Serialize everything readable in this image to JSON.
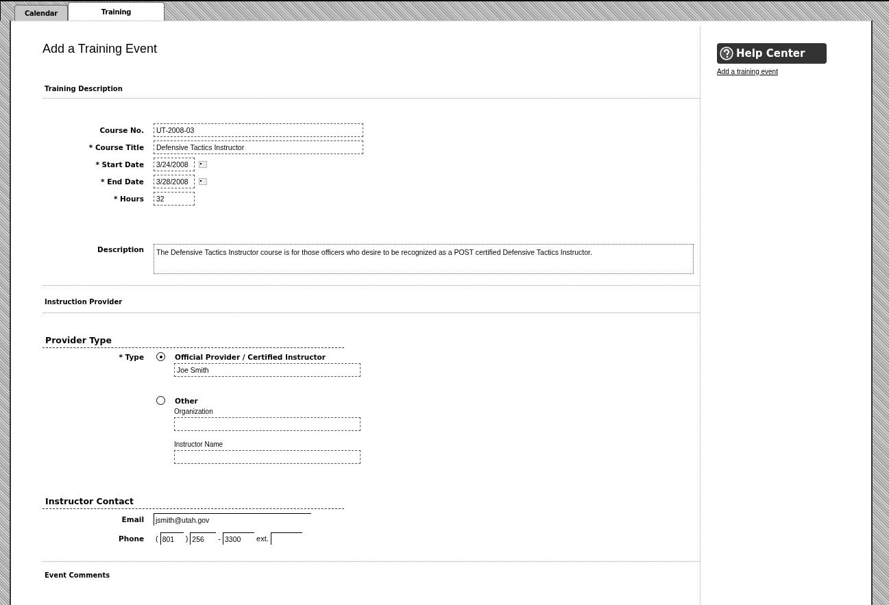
{
  "tabs": [
    {
      "label": "Calendar",
      "selected": false
    },
    {
      "label": "Training",
      "selected": true
    }
  ],
  "page_title": "Add a Training Event",
  "training_description": {
    "heading": "Training Description",
    "fields": [
      {
        "label": "Course No.",
        "kind": "text",
        "value": "UT-2008-03"
      },
      {
        "label": "* Course Title",
        "kind": "text",
        "value": "Defensive Tactics Instructor"
      },
      {
        "label": "* Start Date",
        "kind": "date",
        "value": "3/24/2008"
      },
      {
        "label": "* End Date",
        "kind": "date",
        "value": "3/28/2008"
      },
      {
        "label": "* Hours",
        "kind": "short",
        "value": "32"
      },
      {
        "label": "Description",
        "kind": "textarea",
        "value": "The Defensive Tactics Instructor course is for those officers who desire to be recognized as a POST certified Defensive Tactics Instructor."
      }
    ]
  },
  "instruction_provider": {
    "heading": "Instruction Provider"
  },
  "provider_type": {
    "heading": "Provider Type",
    "label": "* Type",
    "options": [
      {
        "label": "Official Provider / Certified Instructor",
        "selected": true,
        "fields": [
          {
            "value": "Joe Smith"
          }
        ]
      },
      {
        "label": "Other",
        "selected": false,
        "fields": [
          {
            "label": "Organization"
          },
          {
            "label": "Instructor Name"
          }
        ]
      }
    ]
  },
  "instructor_contact": {
    "heading": "Instructor Contact",
    "email_label": "Email",
    "email": "jsmith@utah.gov",
    "phone_label": "Phone",
    "phone": {
      "open": "(",
      "area": "801",
      "close": ")",
      "prefix": "256",
      "dash": "-",
      "line": "3300",
      "ext_label": "ext."
    }
  },
  "event_comments": {
    "heading": "Event Comments"
  },
  "help_center": {
    "title": "Help Center",
    "links": [
      "Add a training event"
    ]
  }
}
